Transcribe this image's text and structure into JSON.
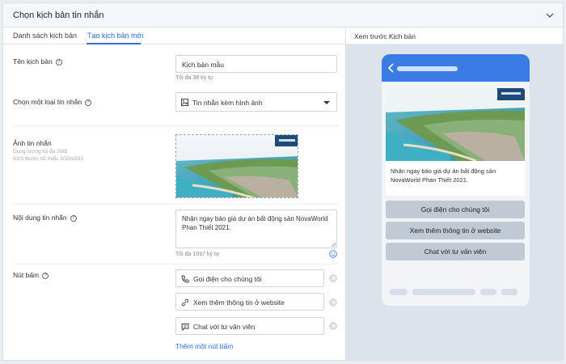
{
  "header": {
    "title": "Chọn kịch bản tin nhắn"
  },
  "tabs": [
    {
      "label": "Danh sách kịch bản"
    },
    {
      "label": "Tạo kịch bản mới"
    }
  ],
  "form": {
    "name": {
      "label": "Tên kịch bản",
      "value": "Kịch bản mẫu",
      "hint": "Tối đa 38 ký tự"
    },
    "type": {
      "label": "Chọn một loại tin nhắn",
      "value": "Tin nhắn kèm hình ảnh"
    },
    "image": {
      "label": "Ảnh tin nhắn",
      "sub1": "Dung lượng tối đa 2MB",
      "sub2": "Kích thước tối thiểu 1024x533"
    },
    "content": {
      "label": "Nội dung tin nhắn",
      "value": "Nhận ngay báo giá dự án bất động sản NovaWorld Phan Thiết 2021.",
      "hint": "Tối đa 1937 ký tự"
    },
    "buttons": {
      "label": "Nút bấm",
      "items": [
        {
          "text": "Gọi điện cho chúng tôi",
          "icon": "phone-icon"
        },
        {
          "text": "Xem thêm thông tin ở website",
          "icon": "link-icon"
        },
        {
          "text": "Chat với tư vấn viên",
          "icon": "chat-icon"
        }
      ],
      "add": "Thêm một nút bấm"
    }
  },
  "preview": {
    "title": "Xem trước Kịch bản",
    "message": "Nhận ngay báo giá dự án bất động sản NovaWorld Phan Thiết 2021.",
    "buttons": [
      "Gọi điện cho chúng tôi",
      "Xem thêm thông tin ở website",
      "Chat với tư vấn viên"
    ]
  },
  "colors": {
    "accent": "#2f6fe0",
    "phone_header": "#3b7be4"
  }
}
